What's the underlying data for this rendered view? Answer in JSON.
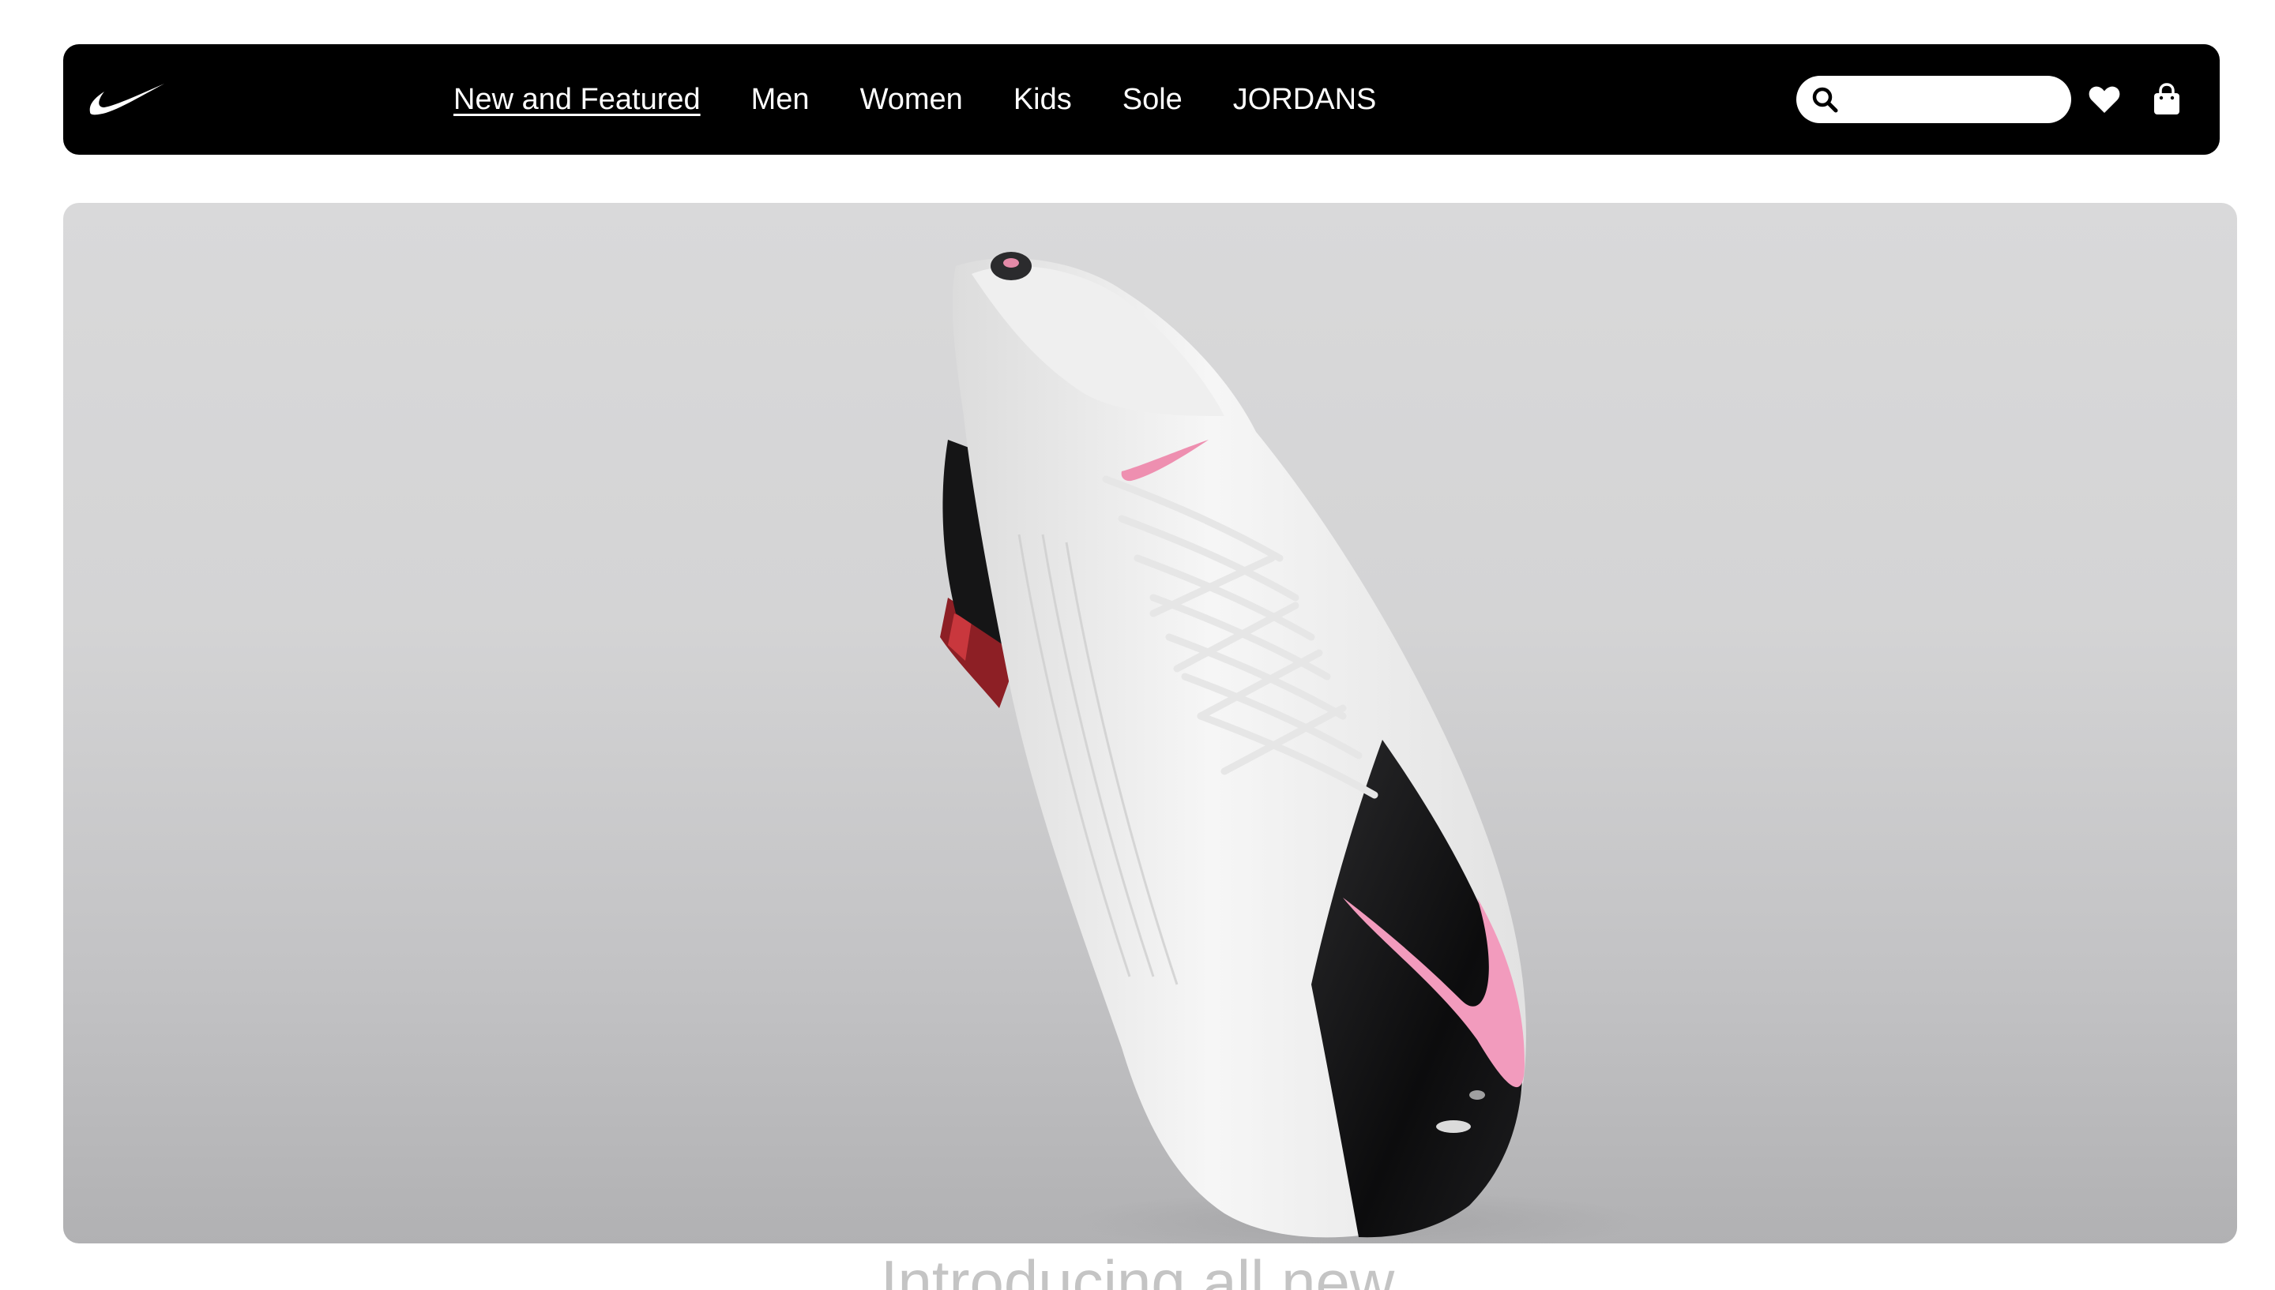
{
  "brand": {
    "logo_icon": "nike-swoosh-icon"
  },
  "nav": {
    "links": [
      {
        "label": "New and Featured",
        "active": true
      },
      {
        "label": "Men",
        "active": false
      },
      {
        "label": "Women",
        "active": false
      },
      {
        "label": "Kids",
        "active": false
      },
      {
        "label": "Sole",
        "active": false
      },
      {
        "label": "JORDANS",
        "active": false
      }
    ]
  },
  "search": {
    "value": "",
    "placeholder": "",
    "icon": "search-icon"
  },
  "actions": {
    "favorites_icon": "heart-icon",
    "bag_icon": "shopping-bag-icon"
  },
  "hero": {
    "image": "football-boot-image",
    "heading": "Introducing all new"
  },
  "colors": {
    "nav_background": "#000000",
    "nav_text": "#ffffff",
    "accent_pink": "#f29bbd",
    "hero_background": "#d4d4d5",
    "heading_text": "#c4c4c4"
  }
}
